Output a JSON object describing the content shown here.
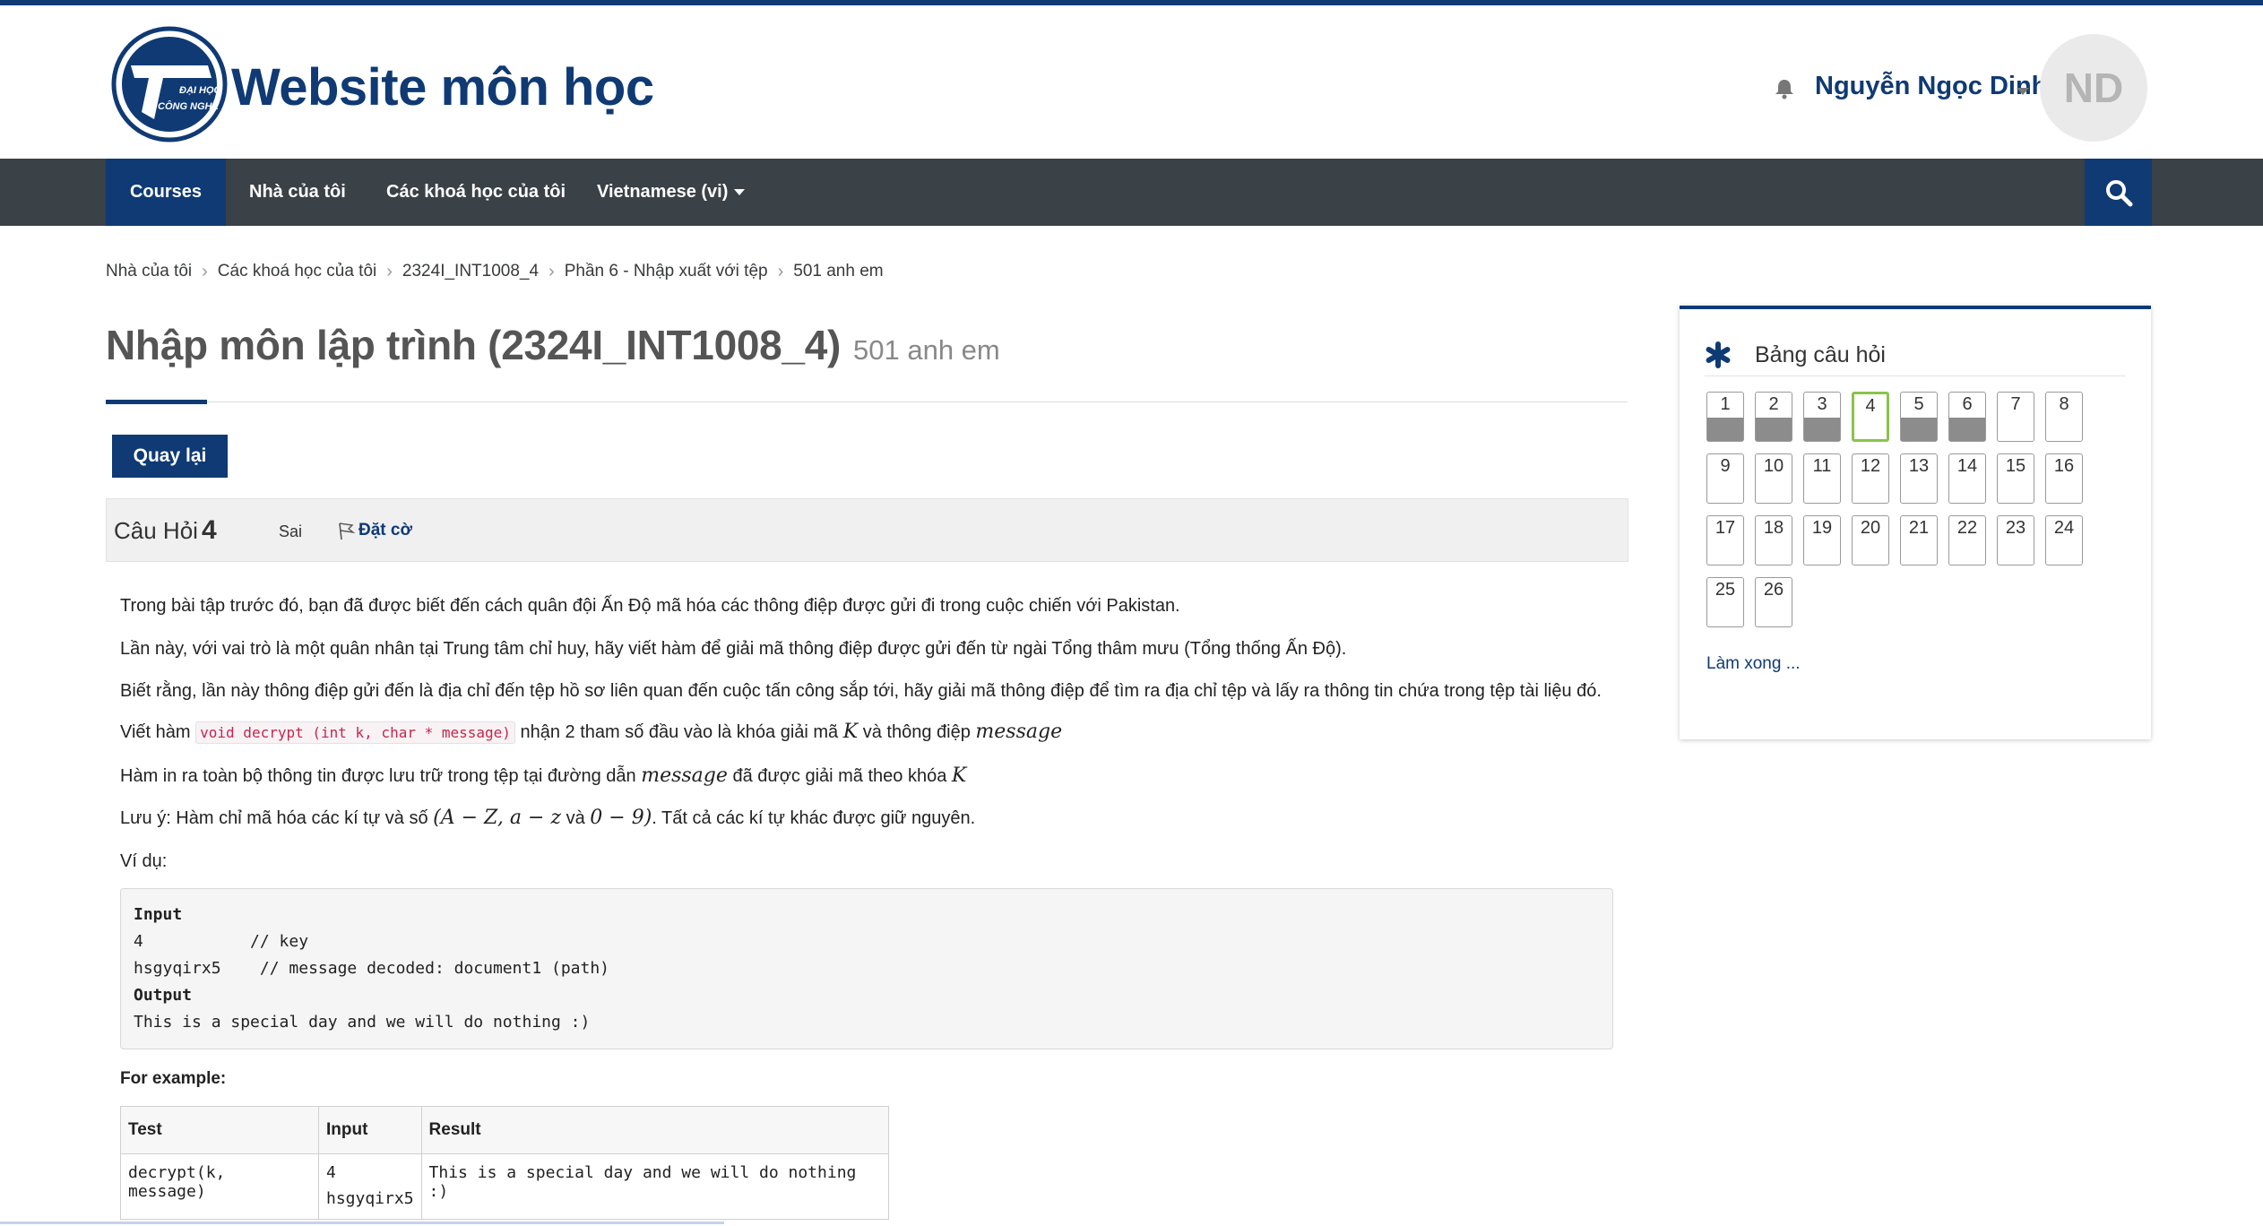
{
  "site": {
    "name": "Website môn học",
    "logo_text": [
      "ĐẠI HỌC",
      "CÔNG NGHỆ"
    ]
  },
  "user": {
    "name": "Nguyễn Ngọc Dinh",
    "initials": "ND"
  },
  "nav": {
    "courses": "Courses",
    "home": "Nhà của tôi",
    "my_courses": "Các khoá học của tôi",
    "language": "Vietnamese (vi)"
  },
  "breadcrumb": [
    "Nhà của tôi",
    "Các khoá học của tôi",
    "2324I_INT1008_4",
    "Phần 6 - Nhập xuất với tệp",
    "501 anh em"
  ],
  "page": {
    "title": "Nhập môn lập trình (2324I_INT1008_4)",
    "subtitle": "501 anh em",
    "back_label": "Quay lại"
  },
  "question": {
    "label": "Câu Hỏi",
    "number": "4",
    "state": "Sai",
    "flag_label": "Đặt cờ",
    "p1": "Trong bài tập trước đó, bạn đã được biết đến cách quân đội Ấn Độ mã hóa các thông điệp được gửi đi trong cuộc chiến với Pakistan.",
    "p2": "Lần này, với vai trò là một quân nhân tại Trung tâm chỉ huy, hãy viết hàm để giải mã thông điệp được gửi đến từ ngài Tổng thâm mưu (Tổng thống Ấn Độ).",
    "p3": "Biết rằng, lần này thông điệp gửi đến là địa chỉ đến tệp hồ sơ liên quan đến cuộc tấn công sắp tới, hãy giải mã thông điệp để tìm ra địa chỉ tệp và lấy ra thông tin chứa trong tệp tài liệu đó.",
    "p4_a": "Viết hàm",
    "p4_code": "void decrypt (int k, char * message)",
    "p4_b": "nhận 2 tham số đầu vào là khóa giải mã",
    "p4_k": "K",
    "p4_c": "và thông điệp",
    "p4_msg": "message",
    "p5_a": "Hàm in ra toàn bộ thông tin được lưu trữ trong tệp tại đường dẫn",
    "p5_msg": "message",
    "p5_b": "đã được giải mã theo khóa",
    "p5_k": "K",
    "p6_a": "Lưu ý: Hàm chỉ mã hóa các kí tự và số",
    "p6_math1": "(A − Z, a − z",
    "p6_va": "và",
    "p6_math2": "0 − 9)",
    "p6_b": ". Tất cả các kí tự khác được giữ nguyên.",
    "p7": "Ví dụ:",
    "pre": {
      "input_label": "Input",
      "line_key": "4           // key",
      "line_msg": "hsgyqirx5    // message decoded: document1 (path)",
      "output_label": "Output",
      "line_out": "This is a special day and we will do nothing :)"
    },
    "for_example": "For example:",
    "table": {
      "headers": [
        "Test",
        "Input",
        "Result"
      ],
      "row": {
        "test": "decrypt(k, message)",
        "input_1": "4",
        "input_2": "hsgyqirx5",
        "result": "This is a special day and we will do nothing :)"
      }
    }
  },
  "quiz_nav": {
    "title": "Bảng câu hỏi",
    "finish": "Làm xong ...",
    "buttons": [
      {
        "n": "1",
        "answered": true
      },
      {
        "n": "2",
        "answered": true
      },
      {
        "n": "3",
        "answered": true
      },
      {
        "n": "4",
        "answered": false,
        "current": true
      },
      {
        "n": "5",
        "answered": true
      },
      {
        "n": "6",
        "answered": true
      },
      {
        "n": "7",
        "answered": false
      },
      {
        "n": "8",
        "answered": false
      },
      {
        "n": "9",
        "answered": false
      },
      {
        "n": "10",
        "answered": false
      },
      {
        "n": "11",
        "answered": false
      },
      {
        "n": "12",
        "answered": false
      },
      {
        "n": "13",
        "answered": false
      },
      {
        "n": "14",
        "answered": false
      },
      {
        "n": "15",
        "answered": false
      },
      {
        "n": "16",
        "answered": false
      },
      {
        "n": "17",
        "answered": false
      },
      {
        "n": "18",
        "answered": false
      },
      {
        "n": "19",
        "answered": false
      },
      {
        "n": "20",
        "answered": false
      },
      {
        "n": "21",
        "answered": false
      },
      {
        "n": "22",
        "answered": false
      },
      {
        "n": "23",
        "answered": false
      },
      {
        "n": "24",
        "answered": false
      },
      {
        "n": "25",
        "answered": false
      },
      {
        "n": "26",
        "answered": false
      }
    ]
  },
  "colors": {
    "brand": "#0f3a74",
    "navbar": "#3a4147",
    "current_question": "#8bc34a",
    "answered_fill": "#8c8c8c"
  }
}
